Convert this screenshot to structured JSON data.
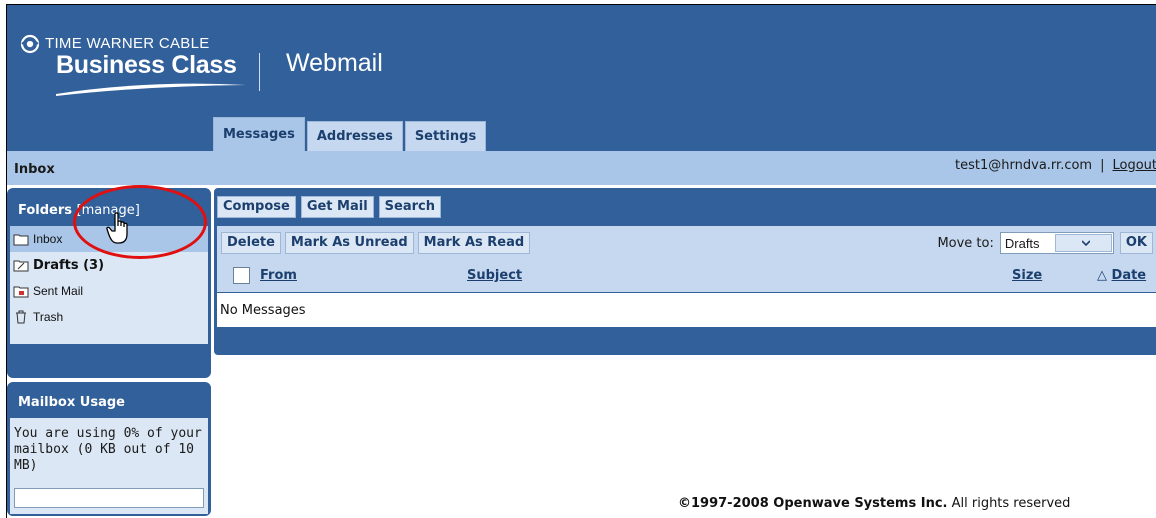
{
  "brand": {
    "line1": "TIME WARNER CABLE",
    "line2": "Business Class"
  },
  "app_title": "Webmail",
  "tabs": [
    {
      "label": "Messages",
      "active": true
    },
    {
      "label": "Addresses",
      "active": false
    },
    {
      "label": "Settings",
      "active": false
    }
  ],
  "inbox_bar": {
    "title": "Inbox",
    "user_email": "test1@hrndva.rr.com",
    "separator": "|",
    "logout_label": "Logout"
  },
  "folders_panel": {
    "title": "Folders",
    "manage_link": "[manage]",
    "folders": [
      {
        "label": "Inbox",
        "icon": "folder-icon",
        "selected": true
      },
      {
        "label": "Drafts (3)",
        "icon": "drafts-folder-icon",
        "bold": true
      },
      {
        "label": "Sent Mail",
        "icon": "sent-folder-icon"
      },
      {
        "label": "Trash",
        "icon": "trash-icon"
      }
    ]
  },
  "mailbox_usage": {
    "title": "Mailbox Usage",
    "text": "You are using 0% of your mailbox (0 KB out of 10 MB)",
    "percent": 0
  },
  "toolbar": {
    "compose": "Compose",
    "get_mail": "Get Mail",
    "search": "Search"
  },
  "actions": {
    "delete": "Delete",
    "mark_unread": "Mark As Unread",
    "mark_read": "Mark As Read",
    "move_to_label": "Move to:",
    "move_to_value": "Drafts",
    "ok": "OK"
  },
  "table": {
    "columns": {
      "from": "From",
      "subject": "Subject",
      "size": "Size",
      "date": "Date"
    },
    "sort_indicator": "△",
    "empty_text": "No Messages"
  },
  "footer": {
    "copyright": "©1997-2008 Openwave Systems Inc.",
    "rights": "All rights reserved"
  },
  "colors": {
    "header_bg": "#32609a",
    "bar_bg": "#a9c6e8",
    "annotation": "#e01010"
  }
}
